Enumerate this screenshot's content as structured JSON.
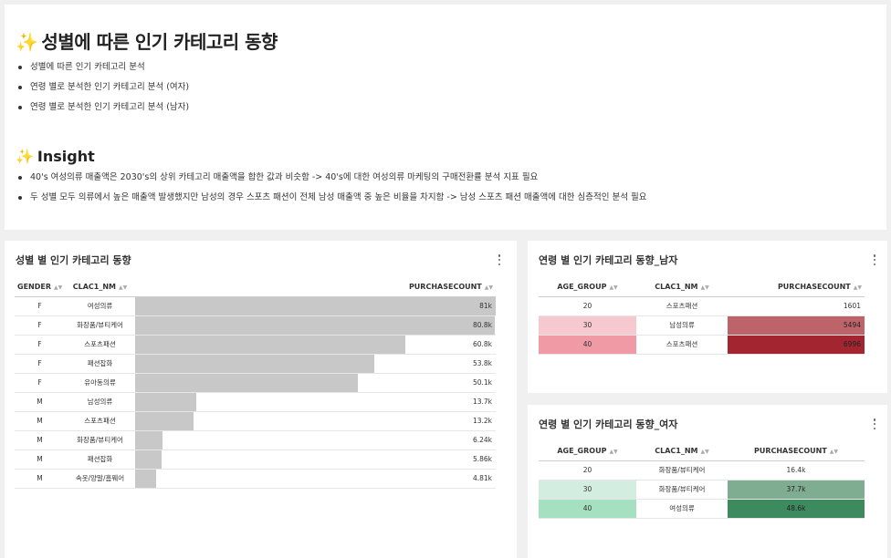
{
  "insight": {
    "title_icon": "✨",
    "title": "성별에 따른 인기 카테고리 동향",
    "bullets": [
      "성별에 따른 인기 카테고리 분석",
      "연령 별로 분석한 인기 카테고리 분석 (여자)",
      "연령 별로 분석한 인기 카테고리 분석 (남자)"
    ],
    "subtitle_icon": "✨",
    "subtitle": "Insight",
    "insights": [
      "40's 여성의류 매출액은 2030's의 상위 카테고리 매출액을 합한 값과 비슷함 -> 40's에 대한 여성의류 마케팅의 구매전환률 분석 지표 필요",
      "두 성별 모두 의류에서 높은 매출액 발생했지만 남성의 경우 스포츠 패션이 전체 남성 매출액 중 높은 비율을 차지함 -> 남성 스포츠 패션 매출액에 대한 심층적인 분석 필요"
    ]
  },
  "gender_panel": {
    "title": "성별 별 인기 카테고리 동향",
    "columns": [
      "GENDER",
      "CLAC1_NM",
      "PURCHASECOUNT"
    ],
    "bar_color": "#c8c8c8",
    "bar_max": 81000,
    "rows": [
      {
        "gender": "F",
        "category": "여성의류",
        "value": 81000,
        "label": "81k"
      },
      {
        "gender": "F",
        "category": "화장품/뷰티케어",
        "value": 80800,
        "label": "80.8k"
      },
      {
        "gender": "F",
        "category": "스포츠패션",
        "value": 60800,
        "label": "60.8k"
      },
      {
        "gender": "F",
        "category": "패션잡화",
        "value": 53800,
        "label": "53.8k"
      },
      {
        "gender": "F",
        "category": "유아동의류",
        "value": 50100,
        "label": "50.1k"
      },
      {
        "gender": "M",
        "category": "남성의류",
        "value": 13700,
        "label": "13.7k"
      },
      {
        "gender": "M",
        "category": "스포츠패션",
        "value": 13200,
        "label": "13.2k"
      },
      {
        "gender": "M",
        "category": "화장품/뷰티케어",
        "value": 6240,
        "label": "6.24k"
      },
      {
        "gender": "M",
        "category": "패션잡화",
        "value": 5860,
        "label": "5.86k"
      },
      {
        "gender": "M",
        "category": "속옷/양말/홈웨어",
        "value": 4810,
        "label": "4.81k"
      }
    ]
  },
  "male_panel": {
    "title": "연령 별 인기 카테고리 동향_남자",
    "columns": [
      "AGE_GROUP",
      "CLAC1_NM",
      "PURCHASECOUNT"
    ],
    "rows": [
      {
        "age": "20",
        "category": "스포츠패션",
        "count": "1601",
        "age_bg": "#ffffff",
        "count_bg": "#ffffff",
        "count_color": "#333333"
      },
      {
        "age": "30",
        "category": "남성의류",
        "count": "5494",
        "age_bg": "#f5c9cf",
        "count_bg": "#bf636b",
        "count_color": "#222222"
      },
      {
        "age": "40",
        "category": "스포츠패션",
        "count": "6996",
        "age_bg": "#ef9aa5",
        "count_bg": "#a3252f",
        "count_color": "#222222"
      }
    ]
  },
  "female_panel": {
    "title": "연령 별 인기 카테고리 동향_여자",
    "columns": [
      "AGE_GROUP",
      "CLAC1_NM",
      "PURCHASECOUNT"
    ],
    "rows": [
      {
        "age": "20",
        "category": "화장품/뷰티케어",
        "count": "16.4k",
        "age_bg": "#ffffff",
        "count_bg": "#ffffff",
        "count_color": "#333333"
      },
      {
        "age": "30",
        "category": "화장품/뷰티케어",
        "count": "37.7k",
        "age_bg": "#d3eee0",
        "count_bg": "#7ead92",
        "count_color": "#222222"
      },
      {
        "age": "40",
        "category": "여성의류",
        "count": "48.6k",
        "age_bg": "#a5e0c1",
        "count_bg": "#3d8a5f",
        "count_color": "#222222"
      }
    ]
  }
}
